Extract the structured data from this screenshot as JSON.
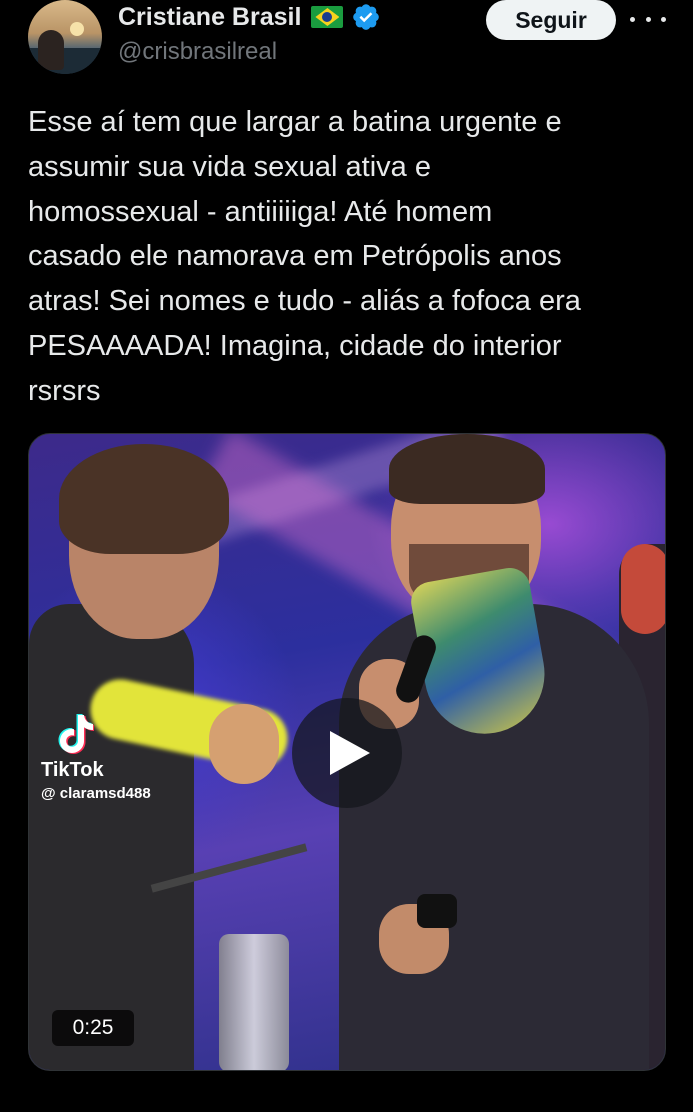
{
  "author": {
    "name": "Cristiane Brasil",
    "handle": "@crisbrasilreal",
    "flag_icon": "brazil-flag-icon",
    "verified_icon": "verified-badge-icon",
    "verified_color": "#1d9bf0"
  },
  "actions": {
    "follow_label": "Seguir",
    "more_icon": "more-horizontal-icon"
  },
  "tweet": {
    "text": "Esse aí tem que largar a batina urgente e\nassumir sua vida sexual ativa e\nhomossexual - antiiiiiga! Até homem\ncasado ele namorava em Petrópolis anos\natras! Sei nomes e tudo - aliás a fofoca era\nPESAAAADA! Imagina, cidade do interior\nrsrsrs"
  },
  "media": {
    "type": "video",
    "duration": "0:25",
    "watermark_app": "TikTok",
    "watermark_user": "@ claramsd488",
    "play_icon": "play-icon",
    "tiktok_icon": "tiktok-logo-icon"
  },
  "colors": {
    "background": "#000000",
    "text_primary": "#e7e9ea",
    "text_secondary": "#71767b",
    "follow_button_bg": "#eff3f4"
  }
}
